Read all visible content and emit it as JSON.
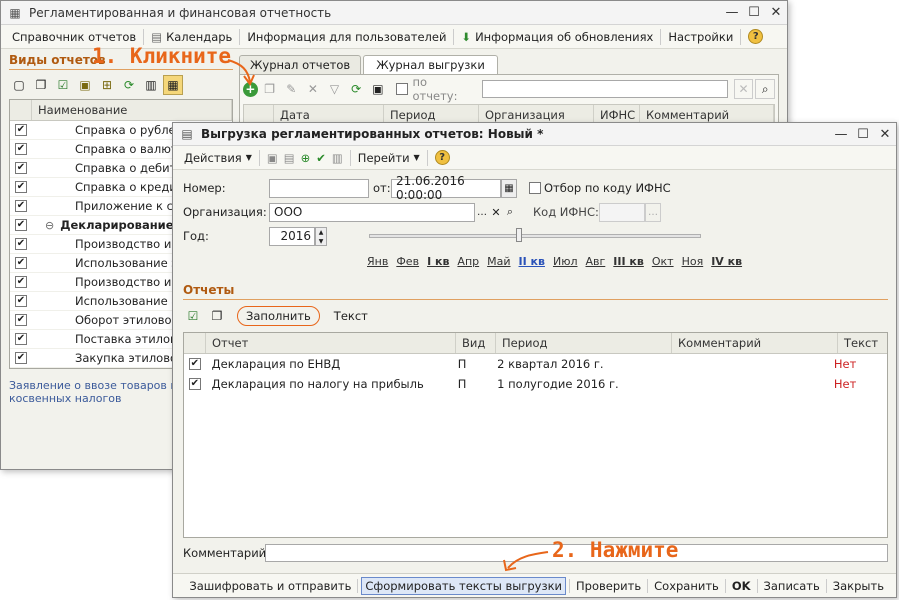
{
  "back_window": {
    "title": "Регламентированная и финансовая отчетность",
    "menu": [
      {
        "label": "Справочник отчетов",
        "icon": ""
      },
      {
        "label": "Календарь",
        "icon": "calendar-icon"
      },
      {
        "label": "Информация для пользователей",
        "icon": ""
      },
      {
        "label": "Информация об обновлениях",
        "icon": "download-icon"
      },
      {
        "label": "Настройки",
        "icon": ""
      }
    ],
    "left_panel_title": "Виды отчетов",
    "tree_header": "Наименование",
    "tree_items": [
      {
        "label": "Справка о рублевы",
        "checked": true,
        "bold": false
      },
      {
        "label": "Справка о валютны",
        "checked": true,
        "bold": false
      },
      {
        "label": "Справка о дебитор",
        "checked": true,
        "bold": false
      },
      {
        "label": "Справка о кредито",
        "checked": true,
        "bold": false
      },
      {
        "label": "Приложение к спра",
        "checked": true,
        "bold": false
      },
      {
        "label": "Декларирование п",
        "checked": true,
        "bold": true
      },
      {
        "label": "Производство и об",
        "checked": true,
        "bold": false
      },
      {
        "label": "Использование эти",
        "checked": true,
        "bold": false
      },
      {
        "label": "Производство и об",
        "checked": true,
        "bold": false
      },
      {
        "label": "Использование ал",
        "checked": true,
        "bold": false
      },
      {
        "label": "Оборот этилового",
        "checked": true,
        "bold": false
      },
      {
        "label": "Поставка этилового",
        "checked": true,
        "bold": false
      },
      {
        "label": "Закупка этилового",
        "checked": true,
        "bold": false
      }
    ],
    "link_text": "Заявление о ввозе товаров и у косвенных налогов",
    "tabs": [
      "Журнал отчетов",
      "Журнал выгрузки"
    ],
    "filter_label": "по отчету:",
    "journal_columns": [
      "Дата",
      "Период",
      "Организация",
      "ИФНС",
      "Комментарий"
    ]
  },
  "annotation1": "1. Кликните",
  "annotation2": "2. Нажмите",
  "dialog": {
    "title": "Выгрузка регламентированных отчетов: Новый *",
    "toolbar": {
      "actions": "Действия",
      "goto": "Перейти"
    },
    "number_label": "Номер:",
    "number_value": "",
    "date_label": "от:",
    "date_value": "21.06.2016  0:00:00",
    "ifns_filter_label": "Отбор по коду ИФНС",
    "org_label": "Организация:",
    "org_value": "ООО",
    "kod_ifns_label": "Код ИФНС:",
    "year_label": "Год:",
    "year_value": "2016",
    "periods": [
      {
        "label": "Янв",
        "bold": false
      },
      {
        "label": "Фев",
        "bold": false
      },
      {
        "label": "I кв",
        "bold": true
      },
      {
        "label": "Апр",
        "bold": false
      },
      {
        "label": "Май",
        "bold": false
      },
      {
        "label": "II кв",
        "bold": true,
        "selected": true
      },
      {
        "label": "Июл",
        "bold": false
      },
      {
        "label": "Авг",
        "bold": false
      },
      {
        "label": "III кв",
        "bold": true
      },
      {
        "label": "Окт",
        "bold": false
      },
      {
        "label": "Ноя",
        "bold": false
      },
      {
        "label": "IV кв",
        "bold": true
      }
    ],
    "reports_title": "Отчеты",
    "fill_button": "Заполнить",
    "text_button": "Текст",
    "columns": [
      "Отчет",
      "Вид",
      "Период",
      "Комментарий",
      "Текст"
    ],
    "rows": [
      {
        "report": "Декларация по ЕНВД",
        "kind": "П",
        "period": "2 квартал 2016 г.",
        "comment": "",
        "text": "Нет",
        "checked": true
      },
      {
        "report": "Декларация по налогу на прибыль",
        "kind": "П",
        "period": "1 полугодие 2016 г.",
        "comment": "",
        "text": "Нет",
        "checked": true
      }
    ],
    "comment_label": "Комментарий:",
    "bottom_buttons": [
      "Зашифровать и отправить",
      "Сформировать тексты выгрузки",
      "Проверить",
      "Сохранить",
      "OK",
      "Записать",
      "Закрыть"
    ],
    "colors": {
      "accent": "#e8661a",
      "link": "#2a52b8",
      "no_text": "#cc2222"
    }
  }
}
